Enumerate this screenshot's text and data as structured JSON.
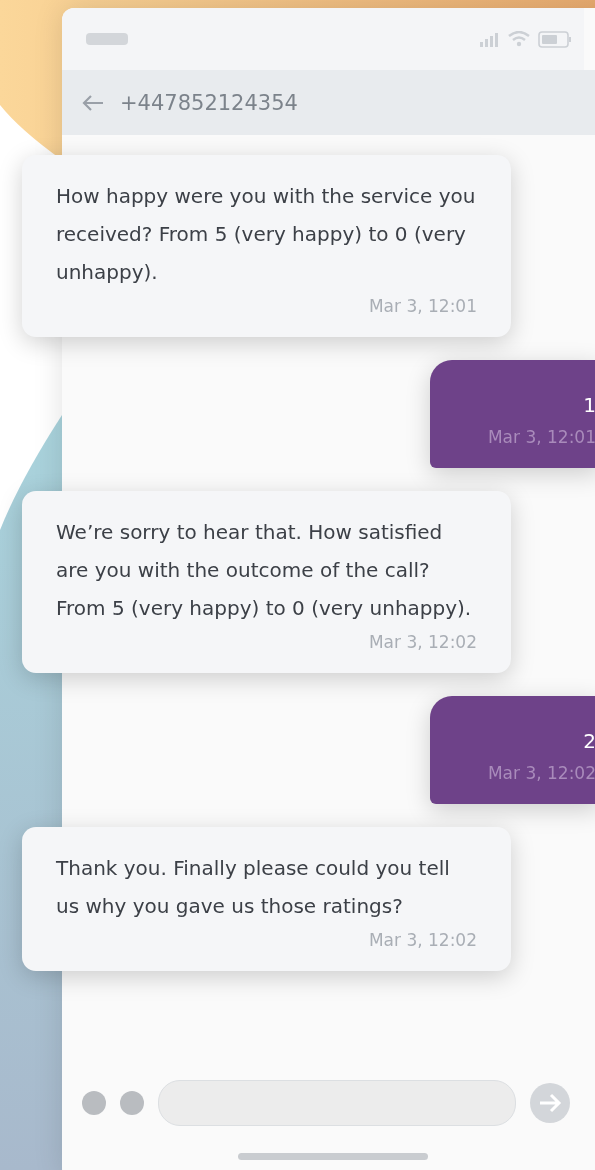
{
  "header": {
    "contact": "+447852124354"
  },
  "messages": [
    {
      "kind": "incoming",
      "text": "How happy were you with the service you received? From 5 (very happy) to 0 (very unhappy).",
      "time": "Mar 3, 12:01"
    },
    {
      "kind": "outgoing",
      "text": "1",
      "time": "Mar 3, 12:01"
    },
    {
      "kind": "incoming",
      "text": "We’re sorry to hear that. How satisfied are you with the outcome of the call? From 5 (very happy) to 0 (very unhappy).",
      "time": "Mar 3, 12:02"
    },
    {
      "kind": "outgoing",
      "text": "2",
      "time": "Mar 3, 12:02"
    },
    {
      "kind": "incoming",
      "text": "Thank you. Finally please could you tell us why you gave us those ratings?",
      "time": "Mar 3, 12:02"
    }
  ]
}
